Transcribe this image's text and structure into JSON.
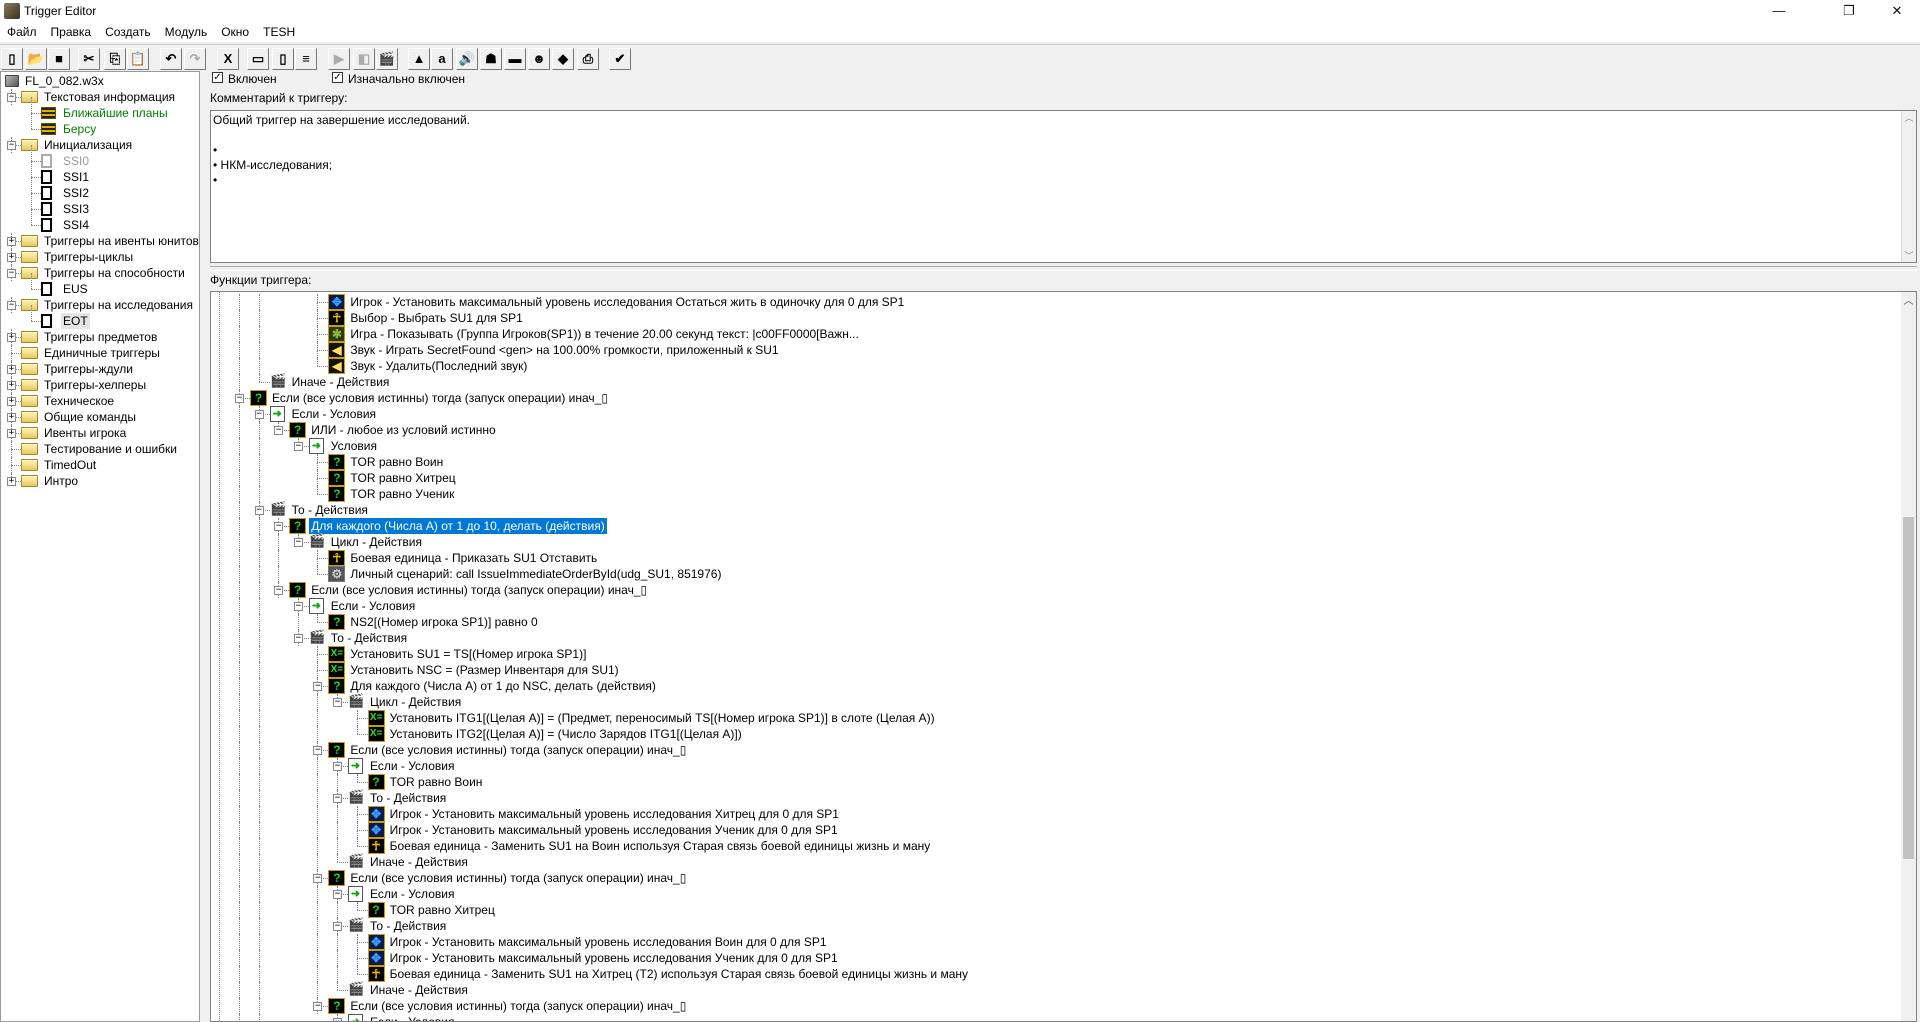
{
  "window": {
    "title": "Trigger Editor",
    "controls": [
      "—",
      "❐",
      "✕"
    ]
  },
  "menu": [
    "Файл",
    "Правка",
    "Создать",
    "Модуль",
    "Окно",
    "TESH"
  ],
  "toolbar": [
    {
      "icon": "new-icon",
      "g": "▯"
    },
    {
      "icon": "open-icon",
      "g": "📂"
    },
    {
      "icon": "save-icon",
      "g": "■"
    },
    {
      "icon": "cut-icon",
      "g": "✂"
    },
    {
      "icon": "copy-icon",
      "g": "⎘"
    },
    {
      "icon": "paste-icon",
      "g": "📋"
    },
    {
      "icon": "undo-icon",
      "g": "↶"
    },
    {
      "icon": "redo-icon",
      "g": "↷",
      "disabled": true
    },
    {
      "icon": "variables-icon",
      "g": "X"
    },
    {
      "icon": "new-category-icon",
      "g": "▭"
    },
    {
      "icon": "new-trigger-icon",
      "g": "▯"
    },
    {
      "icon": "new-comment-icon",
      "g": "≡"
    },
    {
      "icon": "new-event-icon",
      "g": "▶",
      "disabled": true
    },
    {
      "icon": "new-condition-icon",
      "g": "◧",
      "disabled": true
    },
    {
      "icon": "new-action-icon",
      "g": "🎬"
    },
    {
      "icon": "terrain-editor-icon",
      "g": "▲"
    },
    {
      "icon": "trigger-editor-icon",
      "g": "a"
    },
    {
      "icon": "sound-editor-icon",
      "g": "🔊"
    },
    {
      "icon": "object-editor-icon",
      "g": "☗"
    },
    {
      "icon": "campaign-editor-icon",
      "g": "▬"
    },
    {
      "icon": "ai-editor-icon",
      "g": "☻"
    },
    {
      "icon": "import-manager-icon",
      "g": "◆"
    },
    {
      "icon": "script-icon",
      "g": "⎙"
    },
    {
      "icon": "test-map-icon",
      "g": "✔"
    }
  ],
  "left_tree": [
    {
      "level": 0,
      "icon": "map",
      "label": "FL_0_082.w3x"
    },
    {
      "level": 1,
      "icon": "folder-open",
      "label": "Текстовая информация",
      "toggle": "-"
    },
    {
      "level": 2,
      "icon": "comment",
      "label": "Ближайшие планы",
      "color": "#008000"
    },
    {
      "level": 2,
      "icon": "comment",
      "label": "Берсу",
      "color": "#008000"
    },
    {
      "level": 1,
      "icon": "folder-open",
      "label": "Инициализация",
      "toggle": "-"
    },
    {
      "level": 2,
      "icon": "doc-disabled",
      "label": "SSI0",
      "color": "#999999"
    },
    {
      "level": 2,
      "icon": "doc",
      "label": "SSI1"
    },
    {
      "level": 2,
      "icon": "doc",
      "label": "SSI2"
    },
    {
      "level": 2,
      "icon": "doc",
      "label": "SSI3"
    },
    {
      "level": 2,
      "icon": "doc",
      "label": "SSI4"
    },
    {
      "level": 1,
      "icon": "folder",
      "label": "Триггеры на ивенты юнитов",
      "toggle": "+"
    },
    {
      "level": 1,
      "icon": "folder",
      "label": "Триггеры-циклы",
      "toggle": "+"
    },
    {
      "level": 1,
      "icon": "folder-open",
      "label": "Триггеры на способности",
      "toggle": "-"
    },
    {
      "level": 2,
      "icon": "doc",
      "label": "EUS"
    },
    {
      "level": 1,
      "icon": "folder-open",
      "label": "Триггеры на исследования",
      "toggle": "-"
    },
    {
      "level": 2,
      "icon": "doc",
      "label": "EOT",
      "selected": true
    },
    {
      "level": 1,
      "icon": "folder",
      "label": "Триггеры предметов",
      "toggle": "+"
    },
    {
      "level": 1,
      "icon": "folder",
      "label": "Единичные триггеры"
    },
    {
      "level": 1,
      "icon": "folder",
      "label": "Триггеры-ждули",
      "toggle": "+"
    },
    {
      "level": 1,
      "icon": "folder",
      "label": "Триггеры-хелперы",
      "toggle": "+"
    },
    {
      "level": 1,
      "icon": "folder",
      "label": "Техническое",
      "toggle": "+"
    },
    {
      "level": 1,
      "icon": "folder",
      "label": "Общие команды",
      "toggle": "+"
    },
    {
      "level": 1,
      "icon": "folder",
      "label": "Ивенты игрока",
      "toggle": "+"
    },
    {
      "level": 1,
      "icon": "folder",
      "label": "Тестирование и ошибки"
    },
    {
      "level": 1,
      "icon": "folder",
      "label": "TimedOut"
    },
    {
      "level": 1,
      "icon": "folder",
      "label": "Интро",
      "toggle": "+"
    }
  ],
  "trigger": {
    "enabled_label": "Включен",
    "enabled": true,
    "initially_on_label": "Изначально включен",
    "initially_on": true,
    "comment_label": "Комментарий к триггеру:",
    "comment_lines": [
      "Общий триггер на завершение исследований.",
      "",
      "•",
      "• НКМ-исследования;",
      "•"
    ],
    "functions_label": "Функции триггера:"
  },
  "scroll": {
    "position_fraction": 0.5,
    "visible_fraction": 0.35
  },
  "tree_rows": [
    {
      "l": 4,
      "i": "player",
      "t": "Игрок - Установить максимальный уровень исследования Остаться жить в одиночку  для 0 для SP1"
    },
    {
      "l": 4,
      "i": "unit",
      "t": "Выбор - Выбрать SU1 для SP1"
    },
    {
      "l": 4,
      "i": "game",
      "t": "Игра - Показывать (Группа Игроков(SP1)) в течение 20.00 секунд текст: |c00FF0000[Важн..."
    },
    {
      "l": 4,
      "i": "sound",
      "t": "Звук - Играть SecretFound <gen> на 100.00% громкости, приложенный к SU1"
    },
    {
      "l": 4,
      "i": "sound",
      "t": "Звук - Удалить(Последний звук)"
    },
    {
      "l": 1,
      "i": "actions",
      "t": "Иначе - Действия"
    },
    {
      "l": 0,
      "i": "cond",
      "t": "Если (все условия истинны) тогда (запуск операции) инач_▯",
      "tg": 1
    },
    {
      "l": 1,
      "i": "ifcond",
      "t": "Если - Условия",
      "tg": 1
    },
    {
      "l": 2,
      "i": "cond",
      "t": "ИЛИ - любое из условий истинно",
      "tg": 1
    },
    {
      "l": 3,
      "i": "ifcond",
      "t": "Условия",
      "tg": 1
    },
    {
      "l": 4,
      "i": "cond",
      "t": "TOR равно Воин"
    },
    {
      "l": 4,
      "i": "cond",
      "t": "TOR равно Хитрец"
    },
    {
      "l": 4,
      "i": "cond",
      "t": "TOR равно Ученик"
    },
    {
      "l": 1,
      "i": "actions",
      "t": "То - Действия",
      "tg": 1
    },
    {
      "l": 2,
      "i": "cond",
      "t": "Для каждого (Числа А) от 1 до 10, делать (действия)",
      "tg": 1,
      "sel": 1
    },
    {
      "l": 3,
      "i": "actions",
      "t": "Цикл - Действия",
      "tg": 1
    },
    {
      "l": 4,
      "i": "unit",
      "t": "Боевая единица - Приказать SU1 Отставить"
    },
    {
      "l": 4,
      "i": "script",
      "t": "Личный сценарий: call IssueImmediateOrderById(udg_SU1, 851976)"
    },
    {
      "l": 2,
      "i": "cond",
      "t": "Если (все условия истинны) тогда (запуск операции) инач_▯",
      "tg": 1
    },
    {
      "l": 3,
      "i": "ifcond",
      "t": "Если - Условия",
      "tg": 1
    },
    {
      "l": 4,
      "i": "cond",
      "t": "NS2[(Номер игрока SP1)] равно 0"
    },
    {
      "l": 3,
      "i": "actions",
      "t": "То - Действия",
      "tg": 1
    },
    {
      "l": 4,
      "i": "set",
      "t": "Установить SU1 = TS[(Номер игрока SP1)]"
    },
    {
      "l": 4,
      "i": "set",
      "t": "Установить NSC = (Размер Инвентаря для SU1)"
    },
    {
      "l": 4,
      "i": "cond",
      "t": "Для каждого (Числа А) от 1 до NSC, делать (действия)",
      "tg": 1
    },
    {
      "l": 5,
      "i": "actions",
      "t": "Цикл - Действия",
      "tg": 1
    },
    {
      "l": 6,
      "i": "set",
      "t": "Установить ITG1[(Целая А)] = (Предмет, переносимый TS[(Номер игрока SP1)] в слоте (Целая А))"
    },
    {
      "l": 6,
      "i": "set",
      "t": "Установить ITG2[(Целая А)] = (Число Зарядов ITG1[(Целая А)])"
    },
    {
      "l": 4,
      "i": "cond",
      "t": "Если (все условия истинны) тогда (запуск операции) инач_▯",
      "tg": 1
    },
    {
      "l": 5,
      "i": "ifcond",
      "t": "Если - Условия",
      "tg": 1
    },
    {
      "l": 6,
      "i": "cond",
      "t": "TOR равно Воин"
    },
    {
      "l": 5,
      "i": "actions",
      "t": "То - Действия",
      "tg": 1
    },
    {
      "l": 6,
      "i": "player",
      "t": "Игрок - Установить максимальный уровень исследования Хитрец  для 0 для SP1"
    },
    {
      "l": 6,
      "i": "player",
      "t": "Игрок - Установить максимальный уровень исследования Ученик  для 0 для SP1"
    },
    {
      "l": 6,
      "i": "unit",
      "t": "Боевая единица - Заменить SU1 на Воин используя Старая связь боевой единицы жизнь и ману"
    },
    {
      "l": 5,
      "i": "actions",
      "t": "Иначе - Действия"
    },
    {
      "l": 4,
      "i": "cond",
      "t": "Если (все условия истинны) тогда (запуск операции) инач_▯",
      "tg": 1
    },
    {
      "l": 5,
      "i": "ifcond",
      "t": "Если - Условия",
      "tg": 1
    },
    {
      "l": 6,
      "i": "cond",
      "t": "TOR равно Хитрец"
    },
    {
      "l": 5,
      "i": "actions",
      "t": "То - Действия",
      "tg": 1
    },
    {
      "l": 6,
      "i": "player",
      "t": "Игрок - Установить максимальный уровень исследования Воин  для 0 для SP1"
    },
    {
      "l": 6,
      "i": "player",
      "t": "Игрок - Установить максимальный уровень исследования Ученик  для 0 для SP1"
    },
    {
      "l": 6,
      "i": "unit",
      "t": "Боевая единица - Заменить SU1 на Хитрец (T2) используя Старая связь боевой единицы жизнь и ману"
    },
    {
      "l": 5,
      "i": "actions",
      "t": "Иначе - Действия"
    },
    {
      "l": 4,
      "i": "cond",
      "t": "Если (все условия истинны) тогда (запуск операции) инач_▯",
      "tg": 1
    },
    {
      "l": 5,
      "i": "ifcond",
      "t": "Если - Условия",
      "tg": 1
    }
  ]
}
